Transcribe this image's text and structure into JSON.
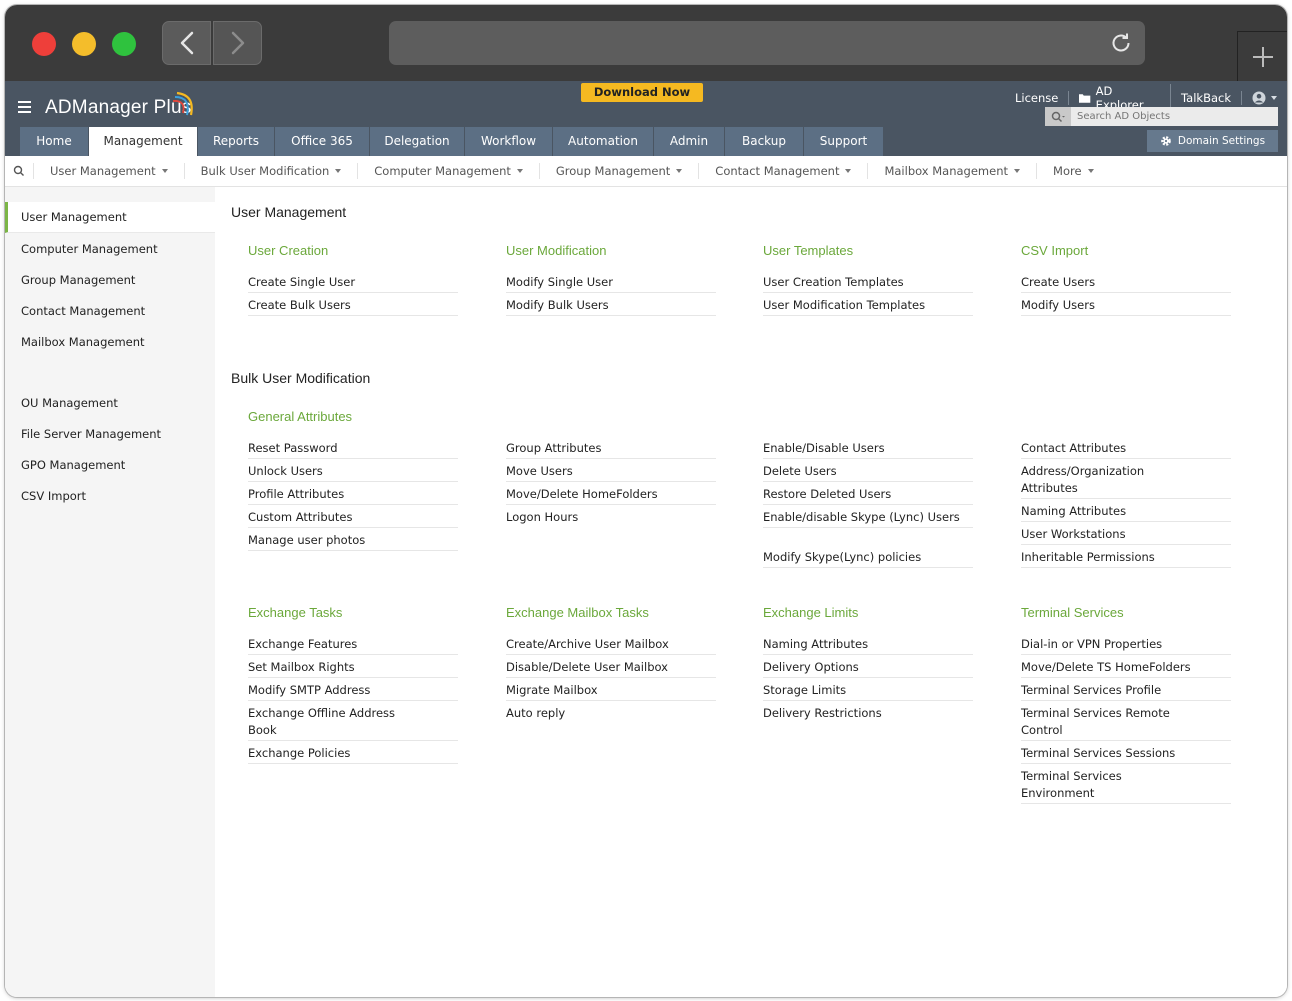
{
  "app": {
    "logo": "ADManager Plus",
    "download_label": "Download Now",
    "top_links": [
      "License",
      "AD Explorer",
      "TalkBack"
    ],
    "search_placeholder": "Search AD Objects",
    "domain_settings_label": "Domain Settings"
  },
  "tabs": [
    "Home",
    "Management",
    "Reports",
    "Office 365",
    "Delegation",
    "Workflow",
    "Automation",
    "Admin",
    "Backup",
    "Support"
  ],
  "subnav": [
    "User Management",
    "Bulk User Modification",
    "Computer Management",
    "Group Management",
    "Contact Management",
    "Mailbox Management",
    "More"
  ],
  "sidebar": [
    "User Management",
    "Computer Management",
    "Group Management",
    "Contact Management",
    "Mailbox Management",
    "OU Management",
    "File Server Management",
    "GPO Management",
    "CSV Import"
  ],
  "sections": {
    "user_management": {
      "title": "User Management",
      "categories": [
        {
          "title": "User Creation",
          "items": [
            "Create Single User",
            "Create Bulk Users"
          ]
        },
        {
          "title": "User Modification",
          "items": [
            "Modify Single User",
            "Modify Bulk Users"
          ]
        },
        {
          "title": "User Templates",
          "items": [
            "User Creation Templates",
            "User Modification Templates"
          ]
        },
        {
          "title": "CSV Import",
          "items": [
            "Create Users",
            "Modify Users"
          ]
        }
      ]
    },
    "bulk_user_modification": {
      "title": "Bulk User Modification",
      "general_title": "General Attributes",
      "general_columns": [
        [
          "Reset Password",
          "Unlock Users",
          "Profile Attributes",
          "Custom Attributes",
          "Manage user photos"
        ],
        [
          "Group Attributes",
          "Move Users",
          "Move/Delete HomeFolders",
          "Logon Hours"
        ],
        [
          "Enable/Disable Users",
          "Delete Users",
          "Restore Deleted Users",
          "Enable/disable Skype (Lync) Users",
          "Modify Skype(Lync) policies"
        ],
        [
          "Contact Attributes",
          "Address/Organization Attributes",
          "Naming Attributes",
          "User Workstations",
          "Inheritable Permissions"
        ]
      ],
      "categories": [
        {
          "title": "Exchange Tasks",
          "items": [
            "Exchange Features",
            "Set Mailbox Rights",
            "Modify SMTP Address",
            "Exchange Offline Address Book",
            "Exchange Policies"
          ]
        },
        {
          "title": "Exchange Mailbox Tasks",
          "items": [
            "Create/Archive User Mailbox",
            "Disable/Delete User Mailbox",
            "Migrate Mailbox",
            "Auto reply"
          ]
        },
        {
          "title": "Exchange Limits",
          "items": [
            "Naming Attributes",
            "Delivery Options",
            "Storage Limits",
            "Delivery Restrictions"
          ]
        },
        {
          "title": "Terminal Services",
          "items": [
            "Dial-in or VPN Properties",
            "Move/Delete TS HomeFolders",
            "Terminal Services Profile",
            "Terminal Services Remote Control",
            "Terminal Services Sessions",
            "Terminal Services Environment"
          ]
        }
      ]
    }
  },
  "colors": {
    "chrome": "#3b3b3b",
    "header": "#4a5562",
    "tab": "#5c6f84",
    "accent_green": "#6ba83b",
    "download": "#f5b921"
  }
}
